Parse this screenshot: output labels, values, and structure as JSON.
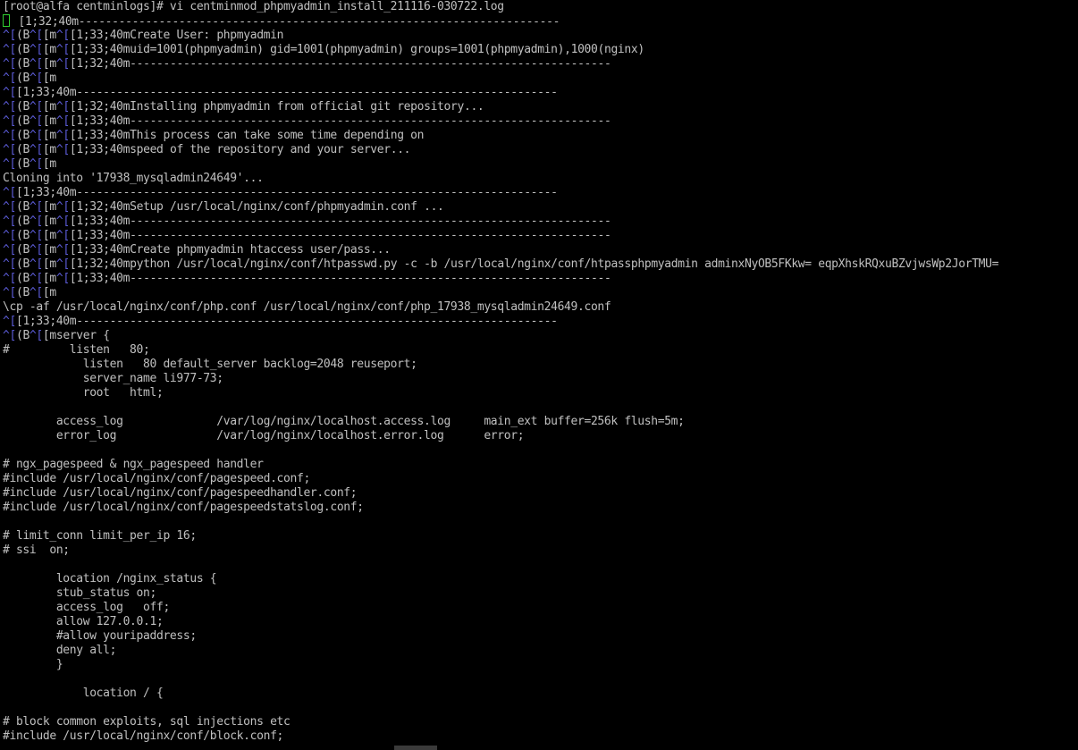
{
  "colors": {
    "background": "#000000",
    "text": "#c0c0c0",
    "escape": "#5b5bd6",
    "cursor": "#2fd02f"
  },
  "lines": [
    {
      "segs": [
        {
          "t": "[root@alfa centminlogs]# vi centminmod_phpmyadmin_install_211116-030722.log"
        }
      ]
    },
    {
      "cursor": true,
      "segs": [
        {
          "t": " [1;32;40m------------------------------------------------------------------------"
        }
      ]
    },
    {
      "segs": [
        {
          "t": "^[",
          "c": "esc"
        },
        {
          "t": "(B"
        },
        {
          "t": "^[",
          "c": "esc"
        },
        {
          "t": "[m"
        },
        {
          "t": "^[",
          "c": "esc"
        },
        {
          "t": "[1;33;40mCreate User: phpmyadmin"
        }
      ]
    },
    {
      "segs": [
        {
          "t": "^[",
          "c": "esc"
        },
        {
          "t": "(B"
        },
        {
          "t": "^[",
          "c": "esc"
        },
        {
          "t": "[m"
        },
        {
          "t": "^[",
          "c": "esc"
        },
        {
          "t": "[1;33;40muid=1001(phpmyadmin) gid=1001(phpmyadmin) groups=1001(phpmyadmin),1000(nginx)"
        }
      ]
    },
    {
      "segs": [
        {
          "t": "^[",
          "c": "esc"
        },
        {
          "t": "(B"
        },
        {
          "t": "^[",
          "c": "esc"
        },
        {
          "t": "[m"
        },
        {
          "t": "^[",
          "c": "esc"
        },
        {
          "t": "[1;32;40m------------------------------------------------------------------------"
        }
      ]
    },
    {
      "segs": [
        {
          "t": "^[",
          "c": "esc"
        },
        {
          "t": "(B"
        },
        {
          "t": "^[",
          "c": "esc"
        },
        {
          "t": "[m"
        }
      ]
    },
    {
      "segs": [
        {
          "t": "^[",
          "c": "esc"
        },
        {
          "t": "[1;33;40m------------------------------------------------------------------------"
        }
      ]
    },
    {
      "segs": [
        {
          "t": "^[",
          "c": "esc"
        },
        {
          "t": "(B"
        },
        {
          "t": "^[",
          "c": "esc"
        },
        {
          "t": "[m"
        },
        {
          "t": "^[",
          "c": "esc"
        },
        {
          "t": "[1;32;40mInstalling phpmyadmin from official git repository..."
        }
      ]
    },
    {
      "segs": [
        {
          "t": "^[",
          "c": "esc"
        },
        {
          "t": "(B"
        },
        {
          "t": "^[",
          "c": "esc"
        },
        {
          "t": "[m"
        },
        {
          "t": "^[",
          "c": "esc"
        },
        {
          "t": "[1;33;40m------------------------------------------------------------------------"
        }
      ]
    },
    {
      "segs": [
        {
          "t": "^[",
          "c": "esc"
        },
        {
          "t": "(B"
        },
        {
          "t": "^[",
          "c": "esc"
        },
        {
          "t": "[m"
        },
        {
          "t": "^[",
          "c": "esc"
        },
        {
          "t": "[1;33;40mThis process can take some time depending on"
        }
      ]
    },
    {
      "segs": [
        {
          "t": "^[",
          "c": "esc"
        },
        {
          "t": "(B"
        },
        {
          "t": "^[",
          "c": "esc"
        },
        {
          "t": "[m"
        },
        {
          "t": "^[",
          "c": "esc"
        },
        {
          "t": "[1;33;40mspeed of the repository and your server..."
        }
      ]
    },
    {
      "segs": [
        {
          "t": "^[",
          "c": "esc"
        },
        {
          "t": "(B"
        },
        {
          "t": "^[",
          "c": "esc"
        },
        {
          "t": "[m"
        }
      ]
    },
    {
      "segs": [
        {
          "t": "Cloning into '17938_mysqladmin24649'..."
        }
      ]
    },
    {
      "segs": [
        {
          "t": "^[",
          "c": "esc"
        },
        {
          "t": "[1;33;40m------------------------------------------------------------------------"
        }
      ]
    },
    {
      "segs": [
        {
          "t": "^[",
          "c": "esc"
        },
        {
          "t": "(B"
        },
        {
          "t": "^[",
          "c": "esc"
        },
        {
          "t": "[m"
        },
        {
          "t": "^[",
          "c": "esc"
        },
        {
          "t": "[1;32;40mSetup /usr/local/nginx/conf/phpmyadmin.conf ..."
        }
      ]
    },
    {
      "segs": [
        {
          "t": "^[",
          "c": "esc"
        },
        {
          "t": "(B"
        },
        {
          "t": "^[",
          "c": "esc"
        },
        {
          "t": "[m"
        },
        {
          "t": "^[",
          "c": "esc"
        },
        {
          "t": "[1;33;40m------------------------------------------------------------------------"
        }
      ]
    },
    {
      "segs": [
        {
          "t": "^[",
          "c": "esc"
        },
        {
          "t": "(B"
        },
        {
          "t": "^[",
          "c": "esc"
        },
        {
          "t": "[m"
        },
        {
          "t": "^[",
          "c": "esc"
        },
        {
          "t": "[1;33;40m------------------------------------------------------------------------"
        }
      ]
    },
    {
      "segs": [
        {
          "t": "^[",
          "c": "esc"
        },
        {
          "t": "(B"
        },
        {
          "t": "^[",
          "c": "esc"
        },
        {
          "t": "[m"
        },
        {
          "t": "^[",
          "c": "esc"
        },
        {
          "t": "[1;33;40mCreate phpmyadmin htaccess user/pass..."
        }
      ]
    },
    {
      "segs": [
        {
          "t": "^[",
          "c": "esc"
        },
        {
          "t": "(B"
        },
        {
          "t": "^[",
          "c": "esc"
        },
        {
          "t": "[m"
        },
        {
          "t": "^[",
          "c": "esc"
        },
        {
          "t": "[1;32;40mpython /usr/local/nginx/conf/htpasswd.py -c -b /usr/local/nginx/conf/htpassphpmyadmin adminxNyOB5FKkw= eqpXhskRQxuBZvjwsWp2JorTMU="
        }
      ]
    },
    {
      "segs": [
        {
          "t": "^[",
          "c": "esc"
        },
        {
          "t": "(B"
        },
        {
          "t": "^[",
          "c": "esc"
        },
        {
          "t": "[m"
        },
        {
          "t": "^[",
          "c": "esc"
        },
        {
          "t": "[1;33;40m------------------------------------------------------------------------"
        }
      ]
    },
    {
      "segs": [
        {
          "t": "^[",
          "c": "esc"
        },
        {
          "t": "(B"
        },
        {
          "t": "^[",
          "c": "esc"
        },
        {
          "t": "[m"
        }
      ]
    },
    {
      "segs": [
        {
          "t": "\\cp -af /usr/local/nginx/conf/php.conf /usr/local/nginx/conf/php_17938_mysqladmin24649.conf"
        }
      ]
    },
    {
      "segs": [
        {
          "t": "^[",
          "c": "esc"
        },
        {
          "t": "[1;33;40m------------------------------------------------------------------------"
        }
      ]
    },
    {
      "segs": [
        {
          "t": "^[",
          "c": "esc"
        },
        {
          "t": "(B"
        },
        {
          "t": "^[",
          "c": "esc"
        },
        {
          "t": "[mserver {"
        }
      ]
    },
    {
      "segs": [
        {
          "t": "#         listen   80;"
        }
      ]
    },
    {
      "segs": [
        {
          "t": "            listen   80 default_server backlog=2048 reuseport;"
        }
      ]
    },
    {
      "segs": [
        {
          "t": "            server_name li977-73;"
        }
      ]
    },
    {
      "segs": [
        {
          "t": "            root   html;"
        }
      ]
    },
    {
      "segs": [
        {
          "t": ""
        }
      ]
    },
    {
      "segs": [
        {
          "t": "        access_log              /var/log/nginx/localhost.access.log     main_ext buffer=256k flush=5m;"
        }
      ]
    },
    {
      "segs": [
        {
          "t": "        error_log               /var/log/nginx/localhost.error.log      error;"
        }
      ]
    },
    {
      "segs": [
        {
          "t": ""
        }
      ]
    },
    {
      "segs": [
        {
          "t": "# ngx_pagespeed & ngx_pagespeed handler"
        }
      ]
    },
    {
      "segs": [
        {
          "t": "#include /usr/local/nginx/conf/pagespeed.conf;"
        }
      ]
    },
    {
      "segs": [
        {
          "t": "#include /usr/local/nginx/conf/pagespeedhandler.conf;"
        }
      ]
    },
    {
      "segs": [
        {
          "t": "#include /usr/local/nginx/conf/pagespeedstatslog.conf;"
        }
      ]
    },
    {
      "segs": [
        {
          "t": ""
        }
      ]
    },
    {
      "segs": [
        {
          "t": "# limit_conn limit_per_ip 16;"
        }
      ]
    },
    {
      "segs": [
        {
          "t": "# ssi  on;"
        }
      ]
    },
    {
      "segs": [
        {
          "t": ""
        }
      ]
    },
    {
      "segs": [
        {
          "t": "        location /nginx_status {"
        }
      ]
    },
    {
      "segs": [
        {
          "t": "        stub_status on;"
        }
      ]
    },
    {
      "segs": [
        {
          "t": "        access_log   off;"
        }
      ]
    },
    {
      "segs": [
        {
          "t": "        allow 127.0.0.1;"
        }
      ]
    },
    {
      "segs": [
        {
          "t": "        #allow youripaddress;"
        }
      ]
    },
    {
      "segs": [
        {
          "t": "        deny all;"
        }
      ]
    },
    {
      "segs": [
        {
          "t": "        }"
        }
      ]
    },
    {
      "segs": [
        {
          "t": ""
        }
      ]
    },
    {
      "segs": [
        {
          "t": "            location / {"
        }
      ]
    },
    {
      "segs": [
        {
          "t": ""
        }
      ]
    },
    {
      "segs": [
        {
          "t": "# block common exploits, sql injections etc"
        }
      ]
    },
    {
      "segs": [
        {
          "t": "#include /usr/local/nginx/conf/block.conf;"
        }
      ]
    }
  ]
}
